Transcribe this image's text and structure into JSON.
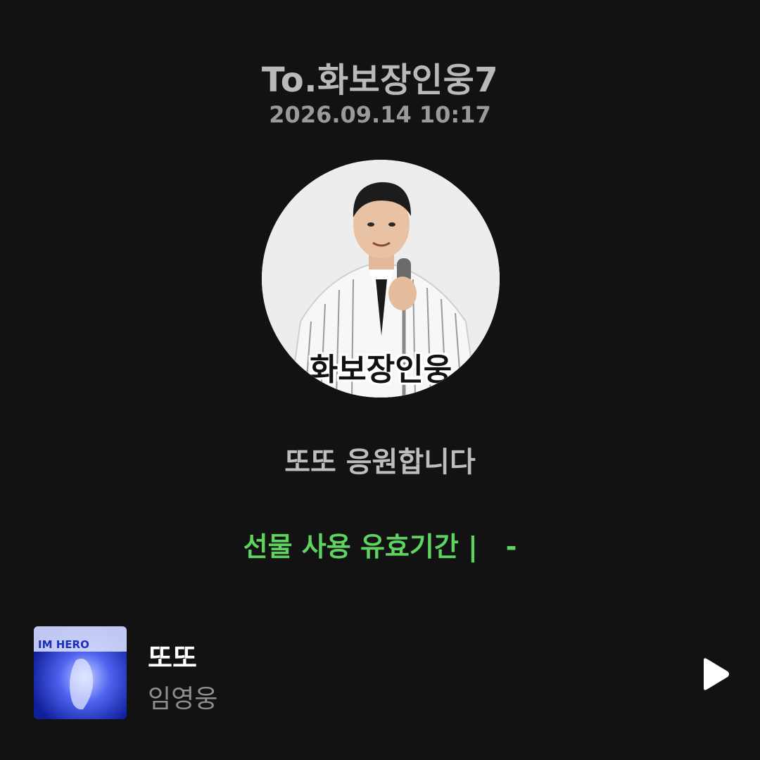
{
  "gift": {
    "recipient": "To.화보장인웅7",
    "timestamp": "2026.09.14 10:17",
    "message": "또또 응원합니다",
    "validity": "선물 사용 유효기간 |   -"
  },
  "profile": {
    "caption": "화보장인웅"
  },
  "song": {
    "title": "또또",
    "artist": "임영웅",
    "album_art_text": "IM HERO"
  },
  "colors": {
    "background": "#121212",
    "accent_green": "#5fd35f",
    "text_gray": "#b9b9b9"
  }
}
